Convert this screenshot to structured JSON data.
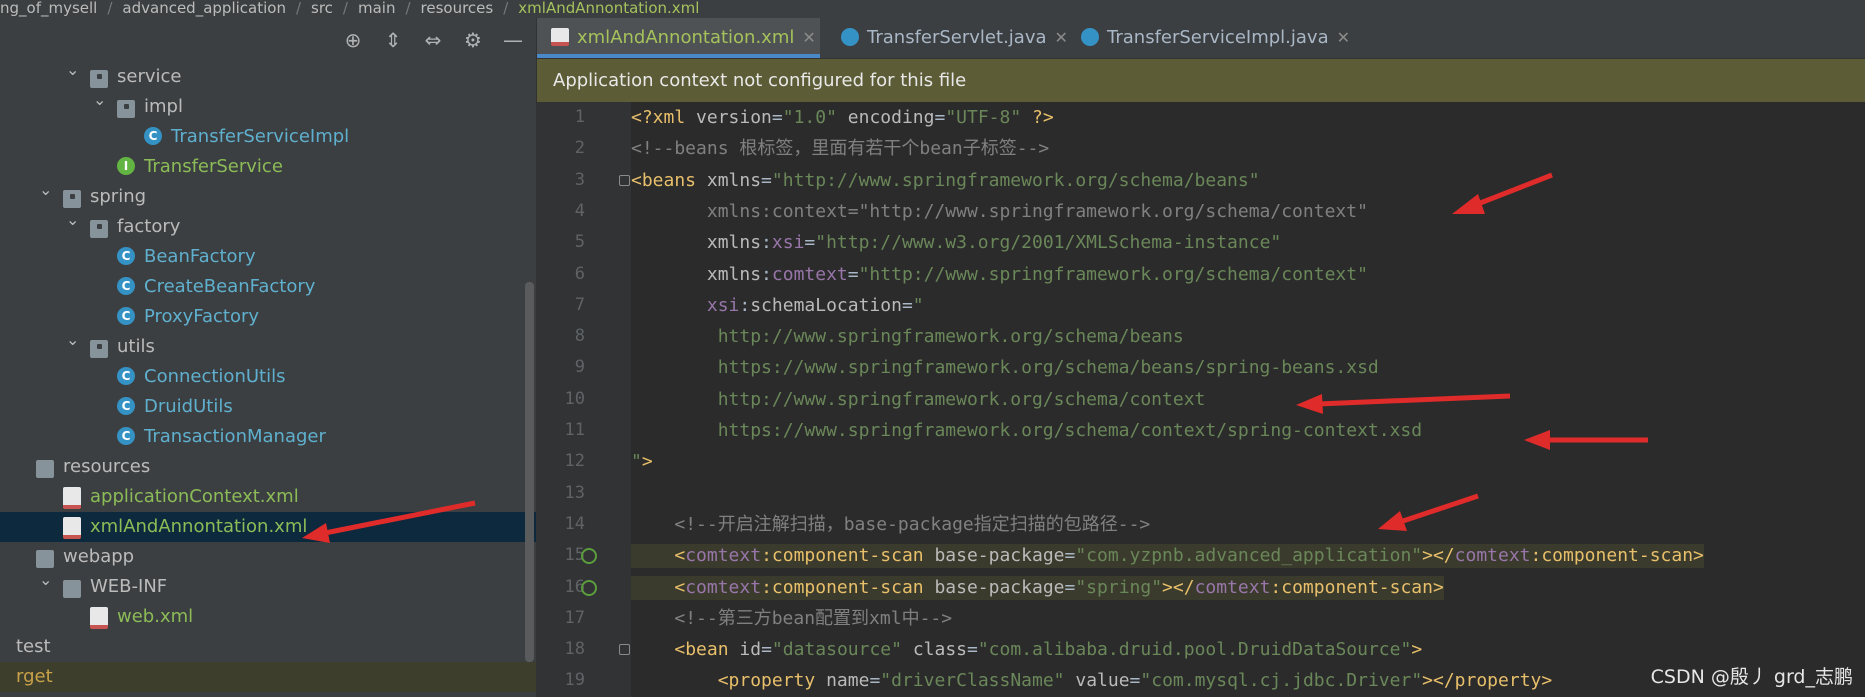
{
  "breadcrumb": [
    "ng_of_mysell",
    "advanced_application",
    "src",
    "main",
    "resources",
    "xmlAndAnnontation.xml"
  ],
  "tree": [
    {
      "label": "service",
      "indent": 1,
      "expanded": true,
      "icon": "folder-pkg"
    },
    {
      "label": "impl",
      "indent": 2,
      "expanded": true,
      "icon": "folder-pkg"
    },
    {
      "label": "TransferServiceImpl",
      "indent": 3,
      "icon": "class",
      "color": "blue"
    },
    {
      "label": "TransferService",
      "indent": 2,
      "icon": "interface",
      "color": "green"
    },
    {
      "label": "spring",
      "indent": 0,
      "expanded": true,
      "icon": "folder-pkg"
    },
    {
      "label": "factory",
      "indent": 1,
      "expanded": true,
      "icon": "folder-pkg"
    },
    {
      "label": "BeanFactory",
      "indent": 2,
      "icon": "class",
      "color": "blue"
    },
    {
      "label": "CreateBeanFactory",
      "indent": 2,
      "icon": "class",
      "color": "blue"
    },
    {
      "label": "ProxyFactory",
      "indent": 2,
      "icon": "class",
      "color": "blue"
    },
    {
      "label": "utils",
      "indent": 1,
      "expanded": true,
      "icon": "folder-pkg"
    },
    {
      "label": "ConnectionUtils",
      "indent": 2,
      "icon": "class",
      "color": "blue"
    },
    {
      "label": "DruidUtils",
      "indent": 2,
      "icon": "class",
      "color": "blue"
    },
    {
      "label": "TransactionManager",
      "indent": 2,
      "icon": "class",
      "color": "blue"
    },
    {
      "label": "resources",
      "indent": -1,
      "icon": "folder"
    },
    {
      "label": "applicationContext.xml",
      "indent": 0,
      "icon": "xml",
      "color": "green"
    },
    {
      "label": "xmlAndAnnontation.xml",
      "indent": 0,
      "icon": "xml",
      "color": "green",
      "selected": true
    },
    {
      "label": "webapp",
      "indent": -1,
      "icon": "folder"
    },
    {
      "label": "WEB-INF",
      "indent": 0,
      "expanded": true,
      "icon": "folder"
    },
    {
      "label": "web.xml",
      "indent": 1,
      "icon": "xml",
      "color": "green"
    },
    {
      "label": "test",
      "indent": -1,
      "icon": "none"
    },
    {
      "label": "rget",
      "indent": -1,
      "icon": "none",
      "last": true
    }
  ],
  "tabs": [
    {
      "label": "xmlAndAnnontation.xml",
      "active": true,
      "icon": "xml"
    },
    {
      "label": "TransferServlet.java",
      "icon": "class"
    },
    {
      "label": "TransferServiceImpl.java",
      "icon": "class"
    }
  ],
  "banner": "Application context not configured for this file",
  "code_lines": [
    "<span class=\"t-pi\">&lt;?xml </span><span class=\"t-attr\">version</span>=<span class=\"t-str\">\"1.0\"</span> <span class=\"t-attr\">encoding</span>=<span class=\"t-str\">\"UTF-8\"</span><span class=\"t-pi\"> ?&gt;</span>",
    "<span class=\"t-cmt\">&lt;!--beans 根标签，里面有若干个bean子标签--&gt;</span>",
    "<span class=\"t-tag\">&lt;beans </span><span class=\"t-attr\">xmlns</span>=<span class=\"t-str\">\"http://www.springframework.org/schema/beans\"</span>",
    "       <span class=\"t-cmt\">xmlns:context=\"http://www.springframework.org/schema/context\"</span>",
    "       <span class=\"t-attr\">xmlns</span>:<span class=\"t-ns\">xsi</span>=<span class=\"t-str\">\"http://www.w3.org/2001/XMLSchema-instance\"</span>",
    "       <span class=\"t-attr\">xmlns</span>:<span class=\"t-ns\">comtext</span>=<span class=\"t-str\">\"http://www.springframework.org/schema/context\"</span>",
    "       <span class=\"t-ns\">xsi</span>:<span class=\"t-attr\">schemaLocation</span>=<span class=\"t-str\">\"</span>",
    "        <span class=\"t-str\">http://www.springframework.org/schema/beans</span>",
    "        <span class=\"t-str\">https://www.springframework.org/schema/beans/spring-beans.xsd</span>",
    "        <span class=\"t-str\">http://www.springframework.org/schema/context</span>",
    "        <span class=\"t-str\">https://www.springframework.org/schema/context/spring-context.xsd</span>",
    "<span class=\"t-str\">\"</span><span class=\"t-tag\">&gt;</span>",
    "",
    "    <span class=\"t-cmt\">&lt;!--开启注解扫描，base-package指定扫描的包路径--&gt;</span>",
    "    <span class=\"t-tag\">&lt;</span><span class=\"t-ns\">comtext</span><span class=\"t-tag\">:component-scan </span><span class=\"t-attr\">base-package</span>=<span class=\"t-str\">\"com.yzpnb.advanced_application\"</span><span class=\"t-tag\">&gt;&lt;/</span><span class=\"t-ns\">comtext</span><span class=\"t-tag\">:component-scan&gt;</span>",
    "    <span class=\"t-tag\">&lt;</span><span class=\"t-ns\">comtext</span><span class=\"t-tag\">:component-scan </span><span class=\"t-attr\">base-package</span>=<span class=\"t-str\">\"spring\"</span><span class=\"t-tag\">&gt;&lt;/</span><span class=\"t-ns\">comtext</span><span class=\"t-tag\">:component-scan&gt;</span>",
    "    <span class=\"t-cmt\">&lt;!--第三方bean配置到xml中--&gt;</span>",
    "    <span class=\"t-tag\">&lt;bean </span><span class=\"t-attr\">id</span>=<span class=\"t-str\">\"datasource\"</span> <span class=\"t-attr\">class</span>=<span class=\"t-str\">\"com.alibaba.druid.pool.DruidDataSource\"</span><span class=\"t-tag\">&gt;</span>",
    "        <span class=\"t-tag\">&lt;property </span><span class=\"t-attr\">name</span>=<span class=\"t-str\">\"driverClassName\"</span> <span class=\"t-attr\">value</span>=<span class=\"t-str\">\"com.mysql.cj.jdbc.Driver\"</span><span class=\"t-tag\">&gt;&lt;/property&gt;</span>"
  ],
  "code_plain": [
    "<?xml version=\"1.0\" encoding=\"UTF-8\" ?>",
    "<!--beans 根标签，里面有若干个bean子标签-->",
    "<beans xmlns=\"http://www.springframework.org/schema/beans\"",
    "xmlns:context=\"http://www.springframework.org/schema/context\"",
    "xmlns:xsi=\"http://www.w3.org/2001/XMLSchema-instance\"",
    "xmlns:comtext=\"http://www.springframework.org/schema/context\"",
    "xsi:schemaLocation=\"",
    "http://www.springframework.org/schema/beans",
    "https://www.springframework.org/schema/beans/spring-beans.xsd",
    "http://www.springframework.org/schema/context",
    "https://www.springframework.org/schema/context/spring-context.xsd",
    "\">",
    "",
    "<!--开启注解扫描，base-package指定扫描的包路径-->",
    "<comtext:component-scan base-package=\"com.yzpnb.advanced_application\"></comtext:component-scan>",
    "<comtext:component-scan base-package=\"spring\"></comtext:component-scan>",
    "<!--第三方bean配置到xml中-->",
    "<bean id=\"datasource\" class=\"com.alibaba.druid.pool.DruidDataSource\">",
    "<property name=\"driverClassName\" value=\"com.mysql.cj.jdbc.Driver\"></property>"
  ],
  "watermark": "CSDN @殷丿 grd_志鹏",
  "colors": {
    "accent": "#4a88c7",
    "banner": "#5c5c36",
    "arrow": "#e02b2b"
  }
}
